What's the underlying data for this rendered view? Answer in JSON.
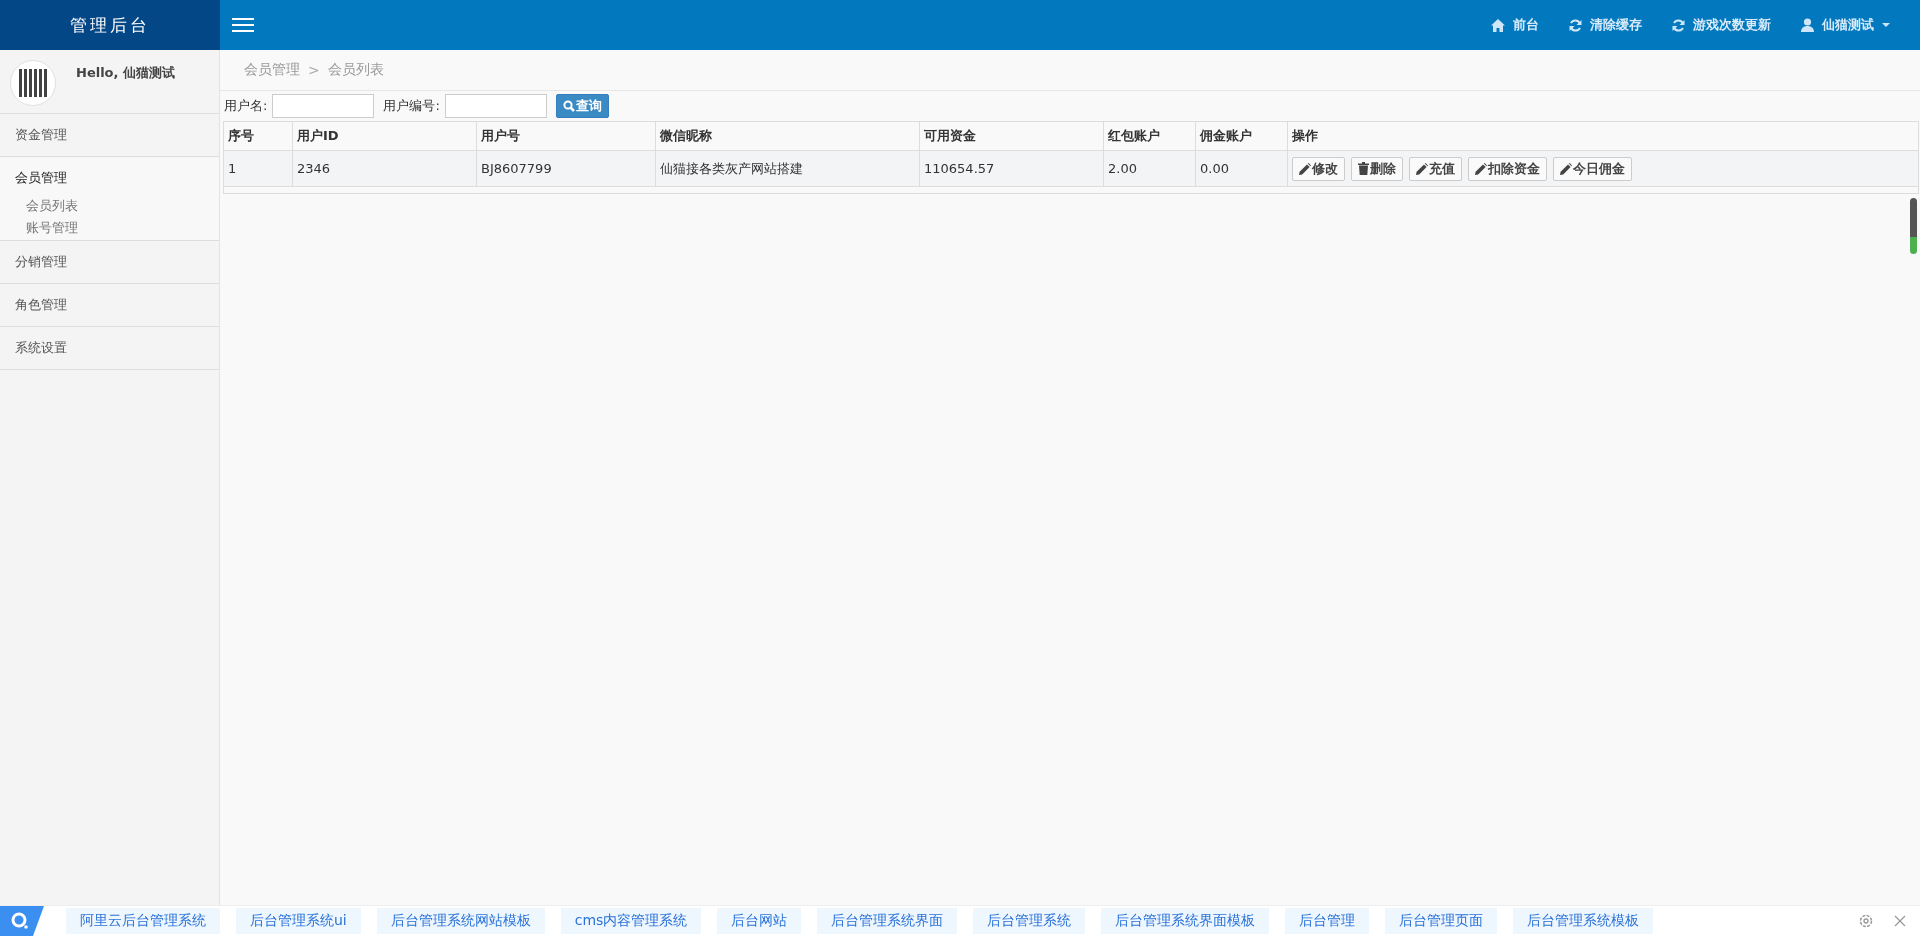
{
  "brand": {
    "title": "管理后台"
  },
  "top_nav": [
    {
      "kind": "home",
      "label": "前台"
    },
    {
      "kind": "refresh",
      "label": "清除缓存"
    },
    {
      "kind": "refresh",
      "label": "游戏次数更新"
    },
    {
      "kind": "user",
      "label": "仙猫测试"
    }
  ],
  "user_panel": {
    "greeting": "Hello, 仙猫测试"
  },
  "sidebar": {
    "items": [
      {
        "label": "资金管理",
        "expanded": false
      },
      {
        "label": "会员管理",
        "expanded": true,
        "children": [
          {
            "label": "会员列表"
          },
          {
            "label": "账号管理"
          }
        ]
      },
      {
        "label": "分销管理",
        "expanded": false
      },
      {
        "label": "角色管理",
        "expanded": false
      },
      {
        "label": "系统设置",
        "expanded": false
      }
    ]
  },
  "breadcrumb": [
    "会员管理",
    "会员列表"
  ],
  "breadcrumb_separator": ">",
  "filters": [
    {
      "label": "用户名:"
    },
    {
      "label": "用户编号:"
    }
  ],
  "search_button": "查询",
  "table": {
    "columns": [
      "序号",
      "用户ID",
      "用户号",
      "微信昵称",
      "可用资金",
      "红包账户",
      "佣金账户",
      "操作"
    ],
    "rows": [
      {
        "cells": [
          "1",
          "2346",
          "BJ8607799",
          "仙猫接各类灰产网站搭建",
          "110654.57",
          "2.00",
          "0.00"
        ],
        "actions": [
          {
            "kind": "edit",
            "label": "修改"
          },
          {
            "kind": "delete",
            "label": "删除"
          },
          {
            "kind": "edit",
            "label": "充值"
          },
          {
            "kind": "edit",
            "label": "扣除资金"
          },
          {
            "kind": "edit",
            "label": "今日佣金"
          }
        ]
      }
    ]
  },
  "suggestion_bar": {
    "tags": [
      "阿里云后台管理系统",
      "后台管理系统ui",
      "后台管理系统网站模板",
      "cms内容管理系统",
      "后台网站",
      "后台管理系统界面",
      "后台管理系统",
      "后台管理系统界面模板",
      "后台管理",
      "后台管理页面",
      "后台管理系统模板"
    ]
  }
}
